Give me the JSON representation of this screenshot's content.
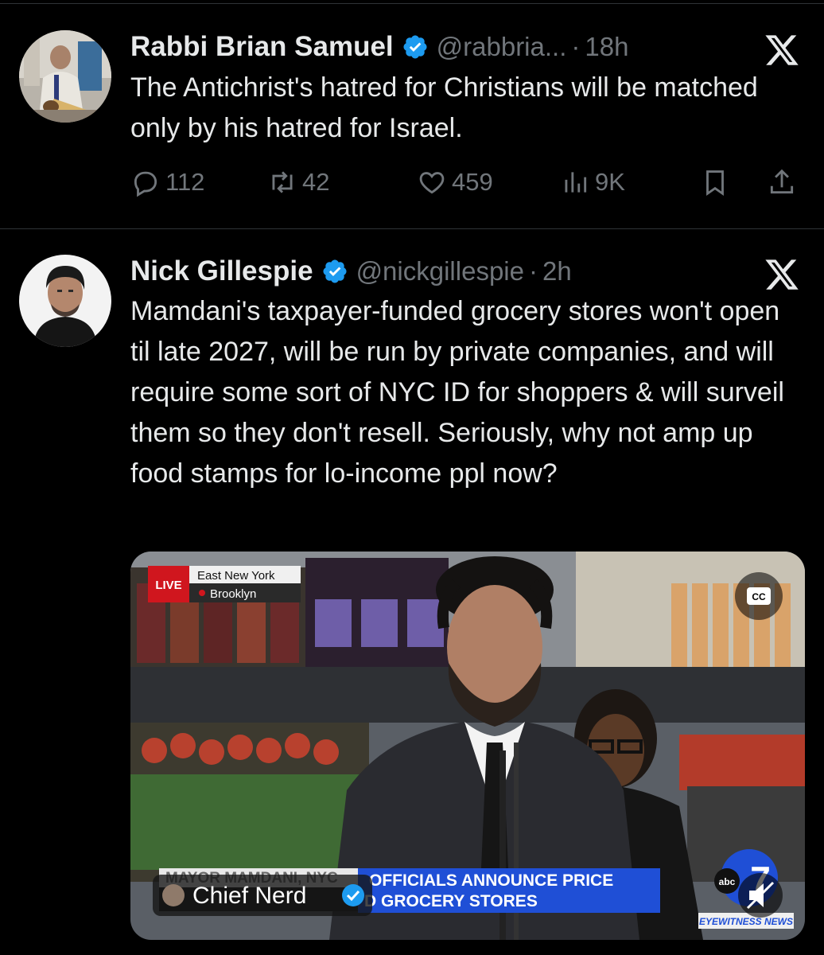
{
  "tweets": [
    {
      "display_name": "Rabbi Brian Samuel",
      "handle": "@rabbria...",
      "dot": "·",
      "time": "18h",
      "text": "The Antichrist's hatred for Christians will be matched only by his hatred for Israel.",
      "replies": "112",
      "reposts": "42",
      "likes": "459",
      "views": "9K"
    },
    {
      "display_name": "Nick Gillespie",
      "handle": "@nickgillespie",
      "dot": "·",
      "time": "2h",
      "text": "Mamdani's taxpayer-funded grocery stores won't open til late 2027, will be run by private companies, and will require some sort of NYC ID for shoppers & will surveil them so they don't resell. Seriously, why not amp up food stamps for lo-income ppl now?",
      "video": {
        "live_label": "LIVE",
        "location_line1": "East New York",
        "location_line2": "Brooklyn",
        "cc_label": "CC",
        "chyron_top_left": "MAYOR MAMDANI, NYC",
        "chyron_top_right": "OFFICIALS ANNOUNCE PRICE",
        "chyron_bottom_right": "D GROCERY STORES",
        "channel_badge": "Chief Nerd",
        "network_logo": "abc",
        "network_number": "7",
        "network_name": "EYEWITNESS NEWS"
      }
    }
  ],
  "colors": {
    "background": "#000000",
    "text": "#e7e9ea",
    "muted": "#71767b",
    "verified": "#1d9bf0",
    "divider": "#2f3336",
    "live_red": "#d0161e",
    "chyron_blue": "#1f4fd6"
  },
  "icons": [
    "verified-badge-icon",
    "x-logo-icon",
    "reply-icon",
    "repost-icon",
    "like-icon",
    "views-icon",
    "bookmark-icon",
    "share-icon",
    "cc-icon",
    "mute-icon"
  ]
}
